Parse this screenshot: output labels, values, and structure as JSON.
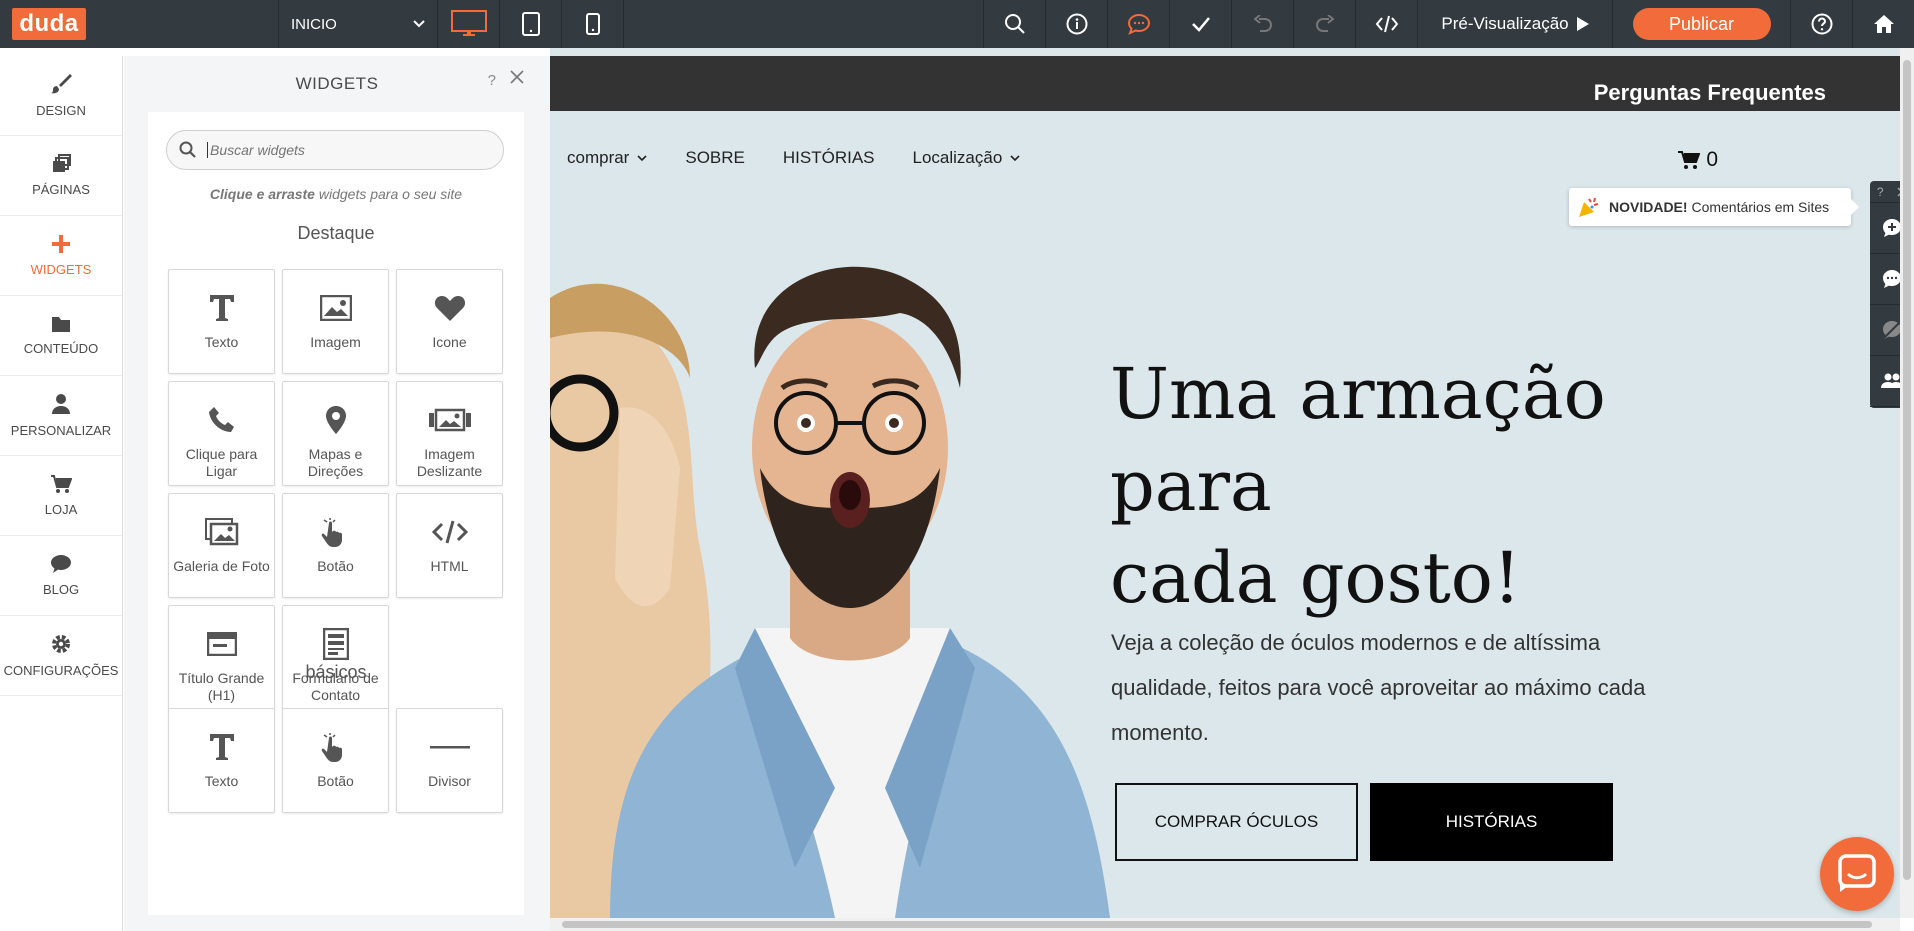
{
  "colors": {
    "accent": "#f26b3a",
    "topbar": "#333a40",
    "hero_bg": "#dce7eb"
  },
  "topbar": {
    "logo": "duda",
    "page_select": "INICIO",
    "devices": [
      "desktop-icon",
      "tablet-icon",
      "mobile-icon"
    ],
    "tools": [
      "search-icon",
      "info-icon",
      "comments-icon",
      "check-icon",
      "undo-icon",
      "redo-icon",
      "code-icon"
    ],
    "preview_label": "Pré-Visualização",
    "publish_label": "Publicar"
  },
  "leftnav": {
    "items": [
      {
        "label": "DESIGN",
        "icon": "brush-icon"
      },
      {
        "label": "PÁGINAS",
        "icon": "pages-icon"
      },
      {
        "label": "WIDGETS",
        "icon": "plus-icon",
        "active": true
      },
      {
        "label": "CONTEÚDO",
        "icon": "folder-icon"
      },
      {
        "label": "PERSONALIZAR",
        "icon": "user-icon"
      },
      {
        "label": "LOJA",
        "icon": "cart-icon"
      },
      {
        "label": "BLOG",
        "icon": "chat-icon"
      },
      {
        "label": "CONFIGURAÇÕES",
        "icon": "gear-icon"
      }
    ]
  },
  "panel": {
    "title": "WIDGETS",
    "help": "?",
    "search_placeholder": "Buscar widgets",
    "hint_bold": "Clique e arraste",
    "hint_rest": " widgets para o seu site",
    "section1": "Destaque",
    "featured": [
      {
        "label": "Texto",
        "icon": "text-icon"
      },
      {
        "label": "Imagem",
        "icon": "image-icon"
      },
      {
        "label": "Icone",
        "icon": "heart-icon"
      },
      {
        "label": "Clique para Ligar",
        "icon": "phone-icon"
      },
      {
        "label": "Mapas e Direções",
        "icon": "map-pin-icon"
      },
      {
        "label": "Imagem Deslizante",
        "icon": "slider-icon"
      },
      {
        "label": "Galeria de Foto",
        "icon": "gallery-icon"
      },
      {
        "label": "Botão",
        "icon": "pointer-icon"
      },
      {
        "label": "HTML",
        "icon": "code-icon"
      },
      {
        "label": "Título Grande (H1)",
        "icon": "title-icon"
      },
      {
        "label": "Formulário de Contato",
        "icon": "form-icon"
      }
    ],
    "section2": "básicos",
    "basics": [
      {
        "label": "Texto",
        "icon": "text-icon"
      },
      {
        "label": "Botão",
        "icon": "pointer-icon"
      },
      {
        "label": "Divisor",
        "icon": "divider-icon"
      }
    ]
  },
  "site": {
    "faq": "Perguntas Frequentes",
    "nav": [
      {
        "label": "comprar",
        "dropdown": true
      },
      {
        "label": "SOBRE",
        "dropdown": false
      },
      {
        "label": "HISTÓRIAS",
        "dropdown": false
      },
      {
        "label": "Localização",
        "dropdown": true
      }
    ],
    "cart_count": "0",
    "headline_lines": [
      "Uma armação",
      "para",
      "cada gosto!"
    ],
    "subtext": "Veja a coleção de óculos modernos e de altíssima qualidade, feitos para você aproveitar ao máximo cada momento.",
    "btn_shop": "COMPRAR ÓCULOS",
    "btn_stories": "HISTÓRIAS"
  },
  "notice": {
    "bold": "NOVIDADE!",
    "text": "Comentários em Sites"
  },
  "rtools": {
    "help": "?",
    "icons": [
      "add-comment-icon",
      "comment-icon",
      "hide-comments-icon",
      "people-icon"
    ]
  }
}
